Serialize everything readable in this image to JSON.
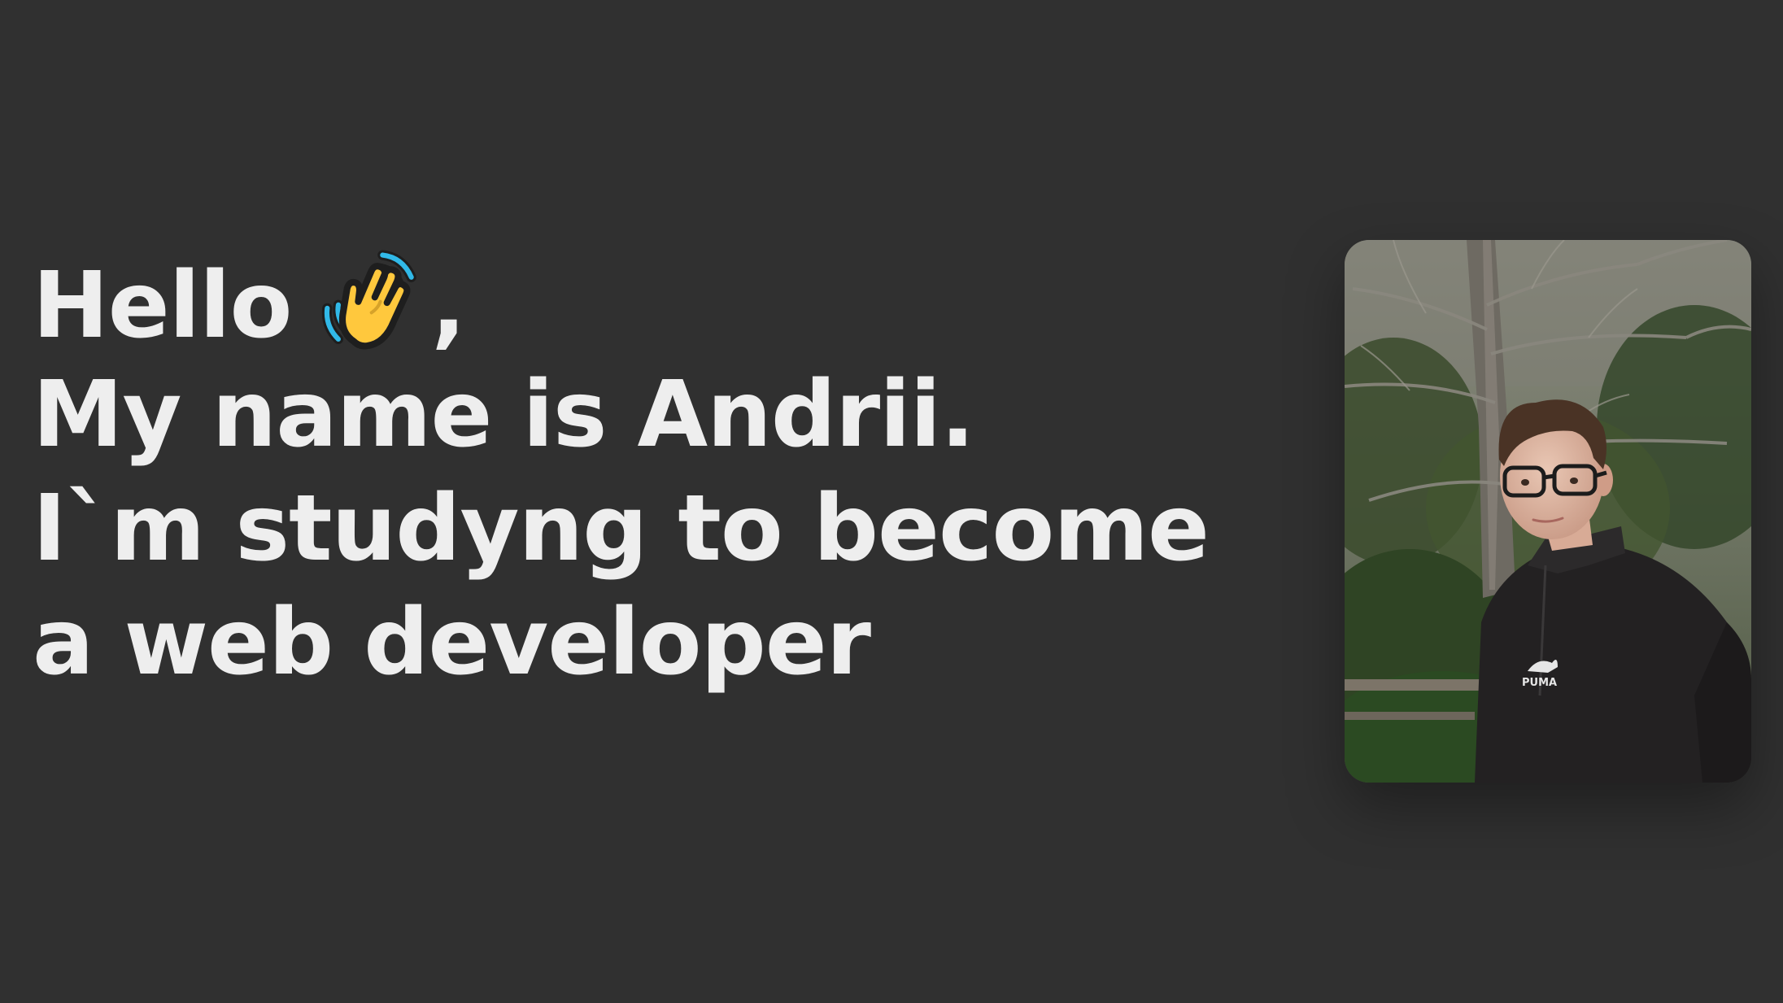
{
  "intro": {
    "greeting": "Hello",
    "greeting_punct": ",",
    "greeting_icon": "waving-hand-icon",
    "line2": "My name is Andrii.",
    "line3": "I`m studyng to become",
    "line4": "a web developer"
  },
  "photo": {
    "subject": "portrait-photo",
    "shirt_logo": "PUMA"
  },
  "colors": {
    "background": "#303030",
    "text": "#eeeeee",
    "wave_hand": "#ffc83d",
    "wave_lines": "#31b9e8"
  }
}
